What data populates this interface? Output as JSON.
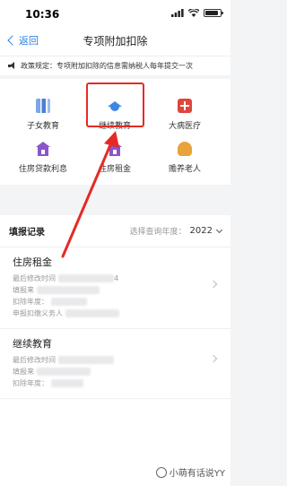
{
  "status": {
    "time": "10:36"
  },
  "nav": {
    "back_label": "返回",
    "title": "专项附加扣除"
  },
  "notice": {
    "text": "政策规定：专项附加扣除的信息需纳税人每年提交一次"
  },
  "grid": {
    "items": [
      {
        "label": "子女教育",
        "icon": "children-education-icon"
      },
      {
        "label": "继续教育",
        "icon": "graduation-cap-icon"
      },
      {
        "label": "大病医疗",
        "icon": "medical-kit-icon"
      },
      {
        "label": "住房贷款利息",
        "icon": "house-loan-icon"
      },
      {
        "label": "住房租金",
        "icon": "house-rent-icon"
      },
      {
        "label": "赡养老人",
        "icon": "elder-support-icon"
      }
    ]
  },
  "records": {
    "title": "填报记录",
    "year_label": "选择查询年度：",
    "year": "2022",
    "items": [
      {
        "name": "住房租金",
        "lines": [
          "最后修改时间",
          "填报来",
          "扣除年度：",
          "申报扣缴义务人"
        ],
        "partial_value": "4"
      },
      {
        "name": "继续教育",
        "lines": [
          "最后修改时间",
          "填报来",
          "扣除年度："
        ]
      }
    ]
  },
  "watermark": {
    "text": "小萌有话说YY"
  },
  "colors": {
    "accent": "#2f7fe5",
    "highlight": "#e52a24"
  }
}
